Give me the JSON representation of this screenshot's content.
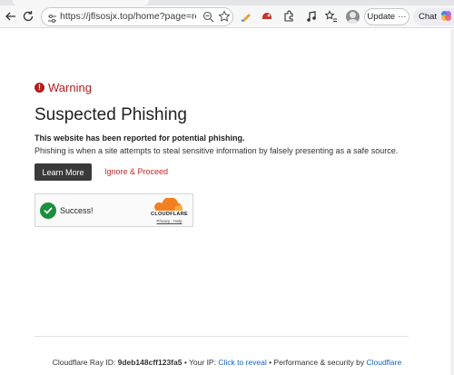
{
  "browser": {
    "url": "https://jflsosjx.top/home?page=reg...",
    "update_label": "Update",
    "update_more": "···",
    "chat_label": "Chat"
  },
  "warning": {
    "label": "Warning",
    "icon_glyph": "!",
    "color": "#b71c1c"
  },
  "headline": "Suspected Phishing",
  "reported_text": "This website has been reported for potential phishing.",
  "explanation": "Phishing is when a site attempts to steal sensitive information by falsely presenting as a safe source.",
  "buttons": {
    "learn_more": "Learn More",
    "ignore": "Ignore & Proceed"
  },
  "captcha": {
    "status": "Success!",
    "brand": "CLOUDFLARE",
    "privacy": "Privacy",
    "separator": " · ",
    "help": "Help"
  },
  "footer": {
    "ray_label": "Cloudflare Ray ID: ",
    "ray_id": "9deb148cff123fa5",
    "sep1": " • ",
    "ip_label": "Your IP: ",
    "ip_link": "Click to reveal",
    "sep2": " • ",
    "perf_label": "Performance & security by ",
    "perf_link": "Cloudflare"
  },
  "colors": {
    "accent_red": "#b71c1c",
    "link_blue": "#1565c0",
    "success_green": "#1a8f3e",
    "cloudflare_orange": "#f38020"
  }
}
